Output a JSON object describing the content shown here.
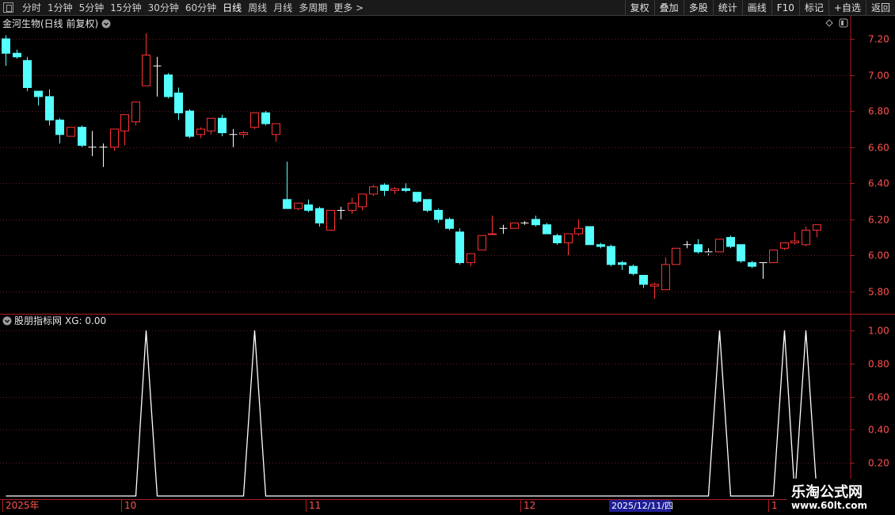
{
  "toolbar": {
    "period_tabs": [
      {
        "label": "分时",
        "active": false
      },
      {
        "label": "1分钟",
        "active": false
      },
      {
        "label": "5分钟",
        "active": false
      },
      {
        "label": "15分钟",
        "active": false
      },
      {
        "label": "30分钟",
        "active": false
      },
      {
        "label": "60分钟",
        "active": false
      },
      {
        "label": "日线",
        "active": true
      },
      {
        "label": "周线",
        "active": false
      },
      {
        "label": "月线",
        "active": false
      },
      {
        "label": "多周期",
        "active": false
      },
      {
        "label": "更多 >",
        "active": false
      }
    ],
    "right_buttons": [
      "复权",
      "叠加",
      "多股",
      "统计",
      "画线",
      "F10",
      "标记",
      "+自选",
      "返回"
    ]
  },
  "main_panel": {
    "title": "金河生物(日线 前复权)",
    "y_ticks": [
      "7.20",
      "7.00",
      "6.80",
      "6.60",
      "6.40",
      "6.20",
      "6.00",
      "5.80"
    ]
  },
  "indicator_panel": {
    "title": "股朋指标网",
    "value_text": "XG: 0.00",
    "y_ticks": [
      "1.00",
      "0.80",
      "0.60",
      "0.40",
      "0.20"
    ]
  },
  "x_axis": {
    "labels": [
      "2025年",
      "10",
      "11",
      "12",
      "1"
    ],
    "cursor_date": "2025/12/11/四"
  },
  "watermark": {
    "title": "乐淘公式网",
    "url": "www.60lt.com"
  },
  "colors": {
    "up": "#ff3232",
    "down": "#54ffff",
    "flat": "#ffffff",
    "grid": "#6e1a1a",
    "axis": "#b01c1c",
    "indicator": "#ffffff"
  },
  "chart_data": {
    "type": "candlestick",
    "price_candles": [
      [
        7.12,
        7.2,
        7.22,
        7.05,
        "down"
      ],
      [
        7.1,
        7.12,
        7.14,
        7.09,
        "down"
      ],
      [
        7.08,
        6.93,
        7.1,
        6.91,
        "down"
      ],
      [
        6.88,
        6.91,
        6.91,
        6.83,
        "down"
      ],
      [
        6.88,
        6.75,
        6.92,
        6.72,
        "down"
      ],
      [
        6.75,
        6.67,
        6.76,
        6.62,
        "down"
      ],
      [
        6.66,
        6.71,
        6.71,
        6.66,
        "up"
      ],
      [
        6.71,
        6.61,
        6.72,
        6.6,
        "down"
      ],
      [
        6.6,
        6.6,
        6.69,
        6.55,
        "flat"
      ],
      [
        6.6,
        6.6,
        6.62,
        6.49,
        "flat"
      ],
      [
        6.6,
        6.7,
        6.7,
        6.58,
        "up"
      ],
      [
        6.69,
        6.78,
        6.78,
        6.61,
        "up"
      ],
      [
        6.74,
        6.85,
        6.85,
        6.72,
        "up"
      ],
      [
        6.94,
        7.11,
        7.23,
        6.94,
        "up"
      ],
      [
        7.05,
        7.05,
        7.1,
        6.88,
        "flat"
      ],
      [
        7.0,
        6.88,
        7.01,
        6.87,
        "down"
      ],
      [
        6.9,
        6.79,
        6.93,
        6.75,
        "down"
      ],
      [
        6.8,
        6.66,
        6.81,
        6.65,
        "down"
      ],
      [
        6.67,
        6.7,
        6.71,
        6.65,
        "up"
      ],
      [
        6.69,
        6.76,
        6.76,
        6.67,
        "up"
      ],
      [
        6.76,
        6.68,
        6.78,
        6.66,
        "down"
      ],
      [
        6.67,
        6.67,
        6.7,
        6.6,
        "flat"
      ],
      [
        6.67,
        6.68,
        6.69,
        6.65,
        "up"
      ],
      [
        6.71,
        6.79,
        6.79,
        6.7,
        "up"
      ],
      [
        6.79,
        6.73,
        6.8,
        6.72,
        "down"
      ],
      [
        6.67,
        6.73,
        6.73,
        6.63,
        "up"
      ],
      [
        6.31,
        6.26,
        6.52,
        6.26,
        "down"
      ],
      [
        6.26,
        6.29,
        6.29,
        6.25,
        "up"
      ],
      [
        6.28,
        6.25,
        6.31,
        6.24,
        "down"
      ],
      [
        6.26,
        6.18,
        6.27,
        6.16,
        "down"
      ],
      [
        6.14,
        6.25,
        6.25,
        6.14,
        "up"
      ],
      [
        6.25,
        6.25,
        6.27,
        6.2,
        "flat"
      ],
      [
        6.25,
        6.29,
        6.32,
        6.23,
        "up"
      ],
      [
        6.27,
        6.34,
        6.34,
        6.25,
        "up"
      ],
      [
        6.34,
        6.38,
        6.39,
        6.33,
        "up"
      ],
      [
        6.39,
        6.36,
        6.4,
        6.33,
        "down"
      ],
      [
        6.36,
        6.37,
        6.38,
        6.34,
        "up"
      ],
      [
        6.37,
        6.36,
        6.4,
        6.35,
        "down"
      ],
      [
        6.35,
        6.3,
        6.35,
        6.29,
        "down"
      ],
      [
        6.31,
        6.25,
        6.31,
        6.24,
        "down"
      ],
      [
        6.25,
        6.2,
        6.26,
        6.18,
        "down"
      ],
      [
        6.2,
        6.15,
        6.21,
        6.14,
        "down"
      ],
      [
        6.13,
        5.96,
        6.15,
        5.95,
        "down"
      ],
      [
        5.96,
        6.01,
        6.01,
        5.94,
        "up"
      ],
      [
        6.03,
        6.11,
        6.11,
        6.03,
        "up"
      ],
      [
        6.12,
        6.12,
        6.22,
        6.12,
        "up"
      ],
      [
        6.15,
        6.15,
        6.17,
        6.12,
        "flat"
      ],
      [
        6.15,
        6.18,
        6.18,
        6.15,
        "up"
      ],
      [
        6.18,
        6.18,
        6.19,
        6.17,
        "flat"
      ],
      [
        6.2,
        6.17,
        6.22,
        6.16,
        "down"
      ],
      [
        6.17,
        6.12,
        6.18,
        6.12,
        "down"
      ],
      [
        6.11,
        6.07,
        6.12,
        6.06,
        "down"
      ],
      [
        6.07,
        6.12,
        6.12,
        6.0,
        "up"
      ],
      [
        6.12,
        6.15,
        6.2,
        6.11,
        "up"
      ],
      [
        6.16,
        6.06,
        6.16,
        6.06,
        "down"
      ],
      [
        6.06,
        6.05,
        6.07,
        6.04,
        "down"
      ],
      [
        6.05,
        5.95,
        6.06,
        5.94,
        "down"
      ],
      [
        5.96,
        5.95,
        5.97,
        5.92,
        "down"
      ],
      [
        5.94,
        5.9,
        5.95,
        5.89,
        "down"
      ],
      [
        5.89,
        5.84,
        5.89,
        5.82,
        "down"
      ],
      [
        5.83,
        5.84,
        5.85,
        5.76,
        "up"
      ],
      [
        5.81,
        5.95,
        5.99,
        5.81,
        "up"
      ],
      [
        5.95,
        6.04,
        6.04,
        5.95,
        "up"
      ],
      [
        6.06,
        6.06,
        6.08,
        6.04,
        "flat"
      ],
      [
        6.06,
        6.02,
        6.09,
        6.01,
        "down"
      ],
      [
        6.02,
        6.01,
        6.04,
        6.0,
        "flat"
      ],
      [
        6.02,
        6.09,
        6.09,
        6.02,
        "up"
      ],
      [
        6.1,
        6.05,
        6.11,
        6.04,
        "down"
      ],
      [
        6.06,
        5.97,
        6.06,
        5.96,
        "down"
      ],
      [
        5.96,
        5.94,
        5.97,
        5.93,
        "down"
      ],
      [
        5.96,
        5.96,
        5.96,
        5.87,
        "flat"
      ],
      [
        5.96,
        6.03,
        6.03,
        5.96,
        "up"
      ],
      [
        6.04,
        6.07,
        6.07,
        6.03,
        "up"
      ],
      [
        6.07,
        6.08,
        6.13,
        6.06,
        "up"
      ],
      [
        6.06,
        6.14,
        6.16,
        6.05,
        "up"
      ],
      [
        6.14,
        6.17,
        6.17,
        6.1,
        "up"
      ]
    ],
    "indicator_name": "XG",
    "indicator_signals": [
      0,
      0,
      0,
      0,
      0,
      0,
      0,
      0,
      0,
      0,
      0,
      0,
      0,
      1,
      0,
      0,
      0,
      0,
      0,
      0,
      0,
      0,
      0,
      1,
      0,
      0,
      0,
      0,
      0,
      0,
      0,
      0,
      0,
      0,
      0,
      0,
      0,
      0,
      0,
      0,
      0,
      0,
      0,
      0,
      0,
      0,
      0,
      0,
      0,
      0,
      0,
      0,
      0,
      0,
      0,
      0,
      0,
      0,
      0,
      0,
      0,
      0,
      0,
      0,
      0,
      0,
      1,
      0,
      0,
      0,
      0,
      0,
      1,
      0,
      1,
      0
    ],
    "price_ylim": [
      5.75,
      7.25
    ],
    "indicator_ylim": [
      0,
      1
    ]
  }
}
